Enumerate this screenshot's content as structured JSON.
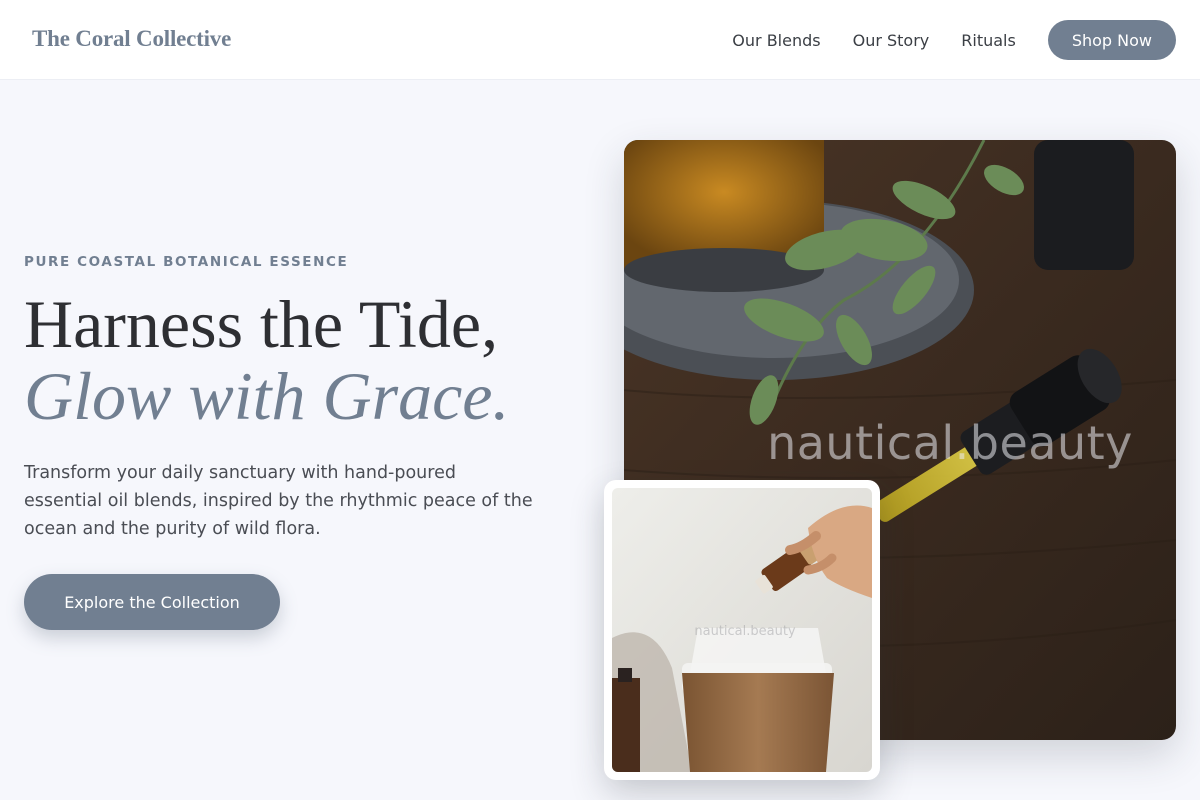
{
  "header": {
    "brand": "The Coral Collective",
    "nav": [
      "Our Blends",
      "Our Story",
      "Rituals"
    ],
    "cta_label": "Shop Now"
  },
  "hero": {
    "eyebrow": "PURE COASTAL BOTANICAL ESSENCE",
    "headline_line1": "Harness the Tide,",
    "headline_line2": "Glow with Grace.",
    "description": "Transform your daily sanctuary with hand-poured essential oil blends, inspired by the rhythmic peace of the ocean and the purity of wild flora.",
    "cta_label": "Explore the Collection"
  },
  "images": {
    "main_watermark": "nautical.beauty",
    "inset_watermark": "nautical.beauty"
  },
  "colors": {
    "accent": "#717f91",
    "background": "#f6f7fc",
    "heading": "#2e2f33"
  }
}
